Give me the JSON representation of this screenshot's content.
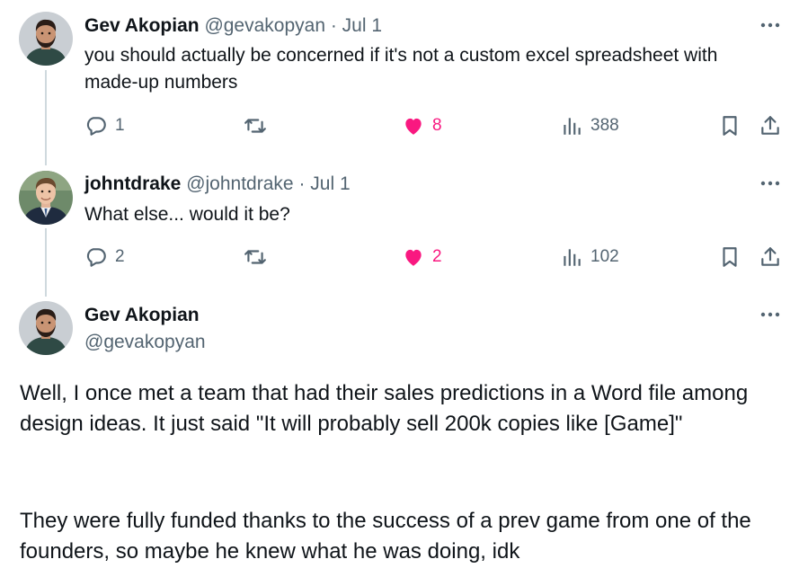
{
  "tweets": [
    {
      "name": "Gev Akopian",
      "handle": "@gevakopyan",
      "date": "· Jul 1",
      "text": "you should actually be concerned if it's not a custom excel spreadsheet with made-up numbers",
      "replies": "1",
      "likes": "8",
      "views": "388",
      "liked": true
    },
    {
      "name": "johntdrake",
      "handle": "@johntdrake",
      "date": "· Jul 1",
      "text": "What else... would it be?",
      "replies": "2",
      "likes": "2",
      "views": "102",
      "liked": true
    }
  ],
  "main": {
    "name": "Gev Akopian",
    "handle": "@gevakopyan",
    "paragraph1": "Well, I once met a team that had their sales predictions in a Word file among design ideas. It just said \"It will probably sell 200k copies like [Game]\"",
    "paragraph2": "They were fully funded thanks to the success of a prev game from one of the founders, so maybe he knew what he was doing, idk"
  },
  "icons": {
    "reply": "reply-icon",
    "retweet": "retweet-icon",
    "like": "heart-icon",
    "views": "views-icon",
    "bookmark": "bookmark-icon",
    "share": "share-icon",
    "more": "more-icon"
  },
  "colors": {
    "like": "#f91880",
    "muted": "#536471",
    "text": "#0f1419",
    "thread_line": "#cfd9de"
  }
}
